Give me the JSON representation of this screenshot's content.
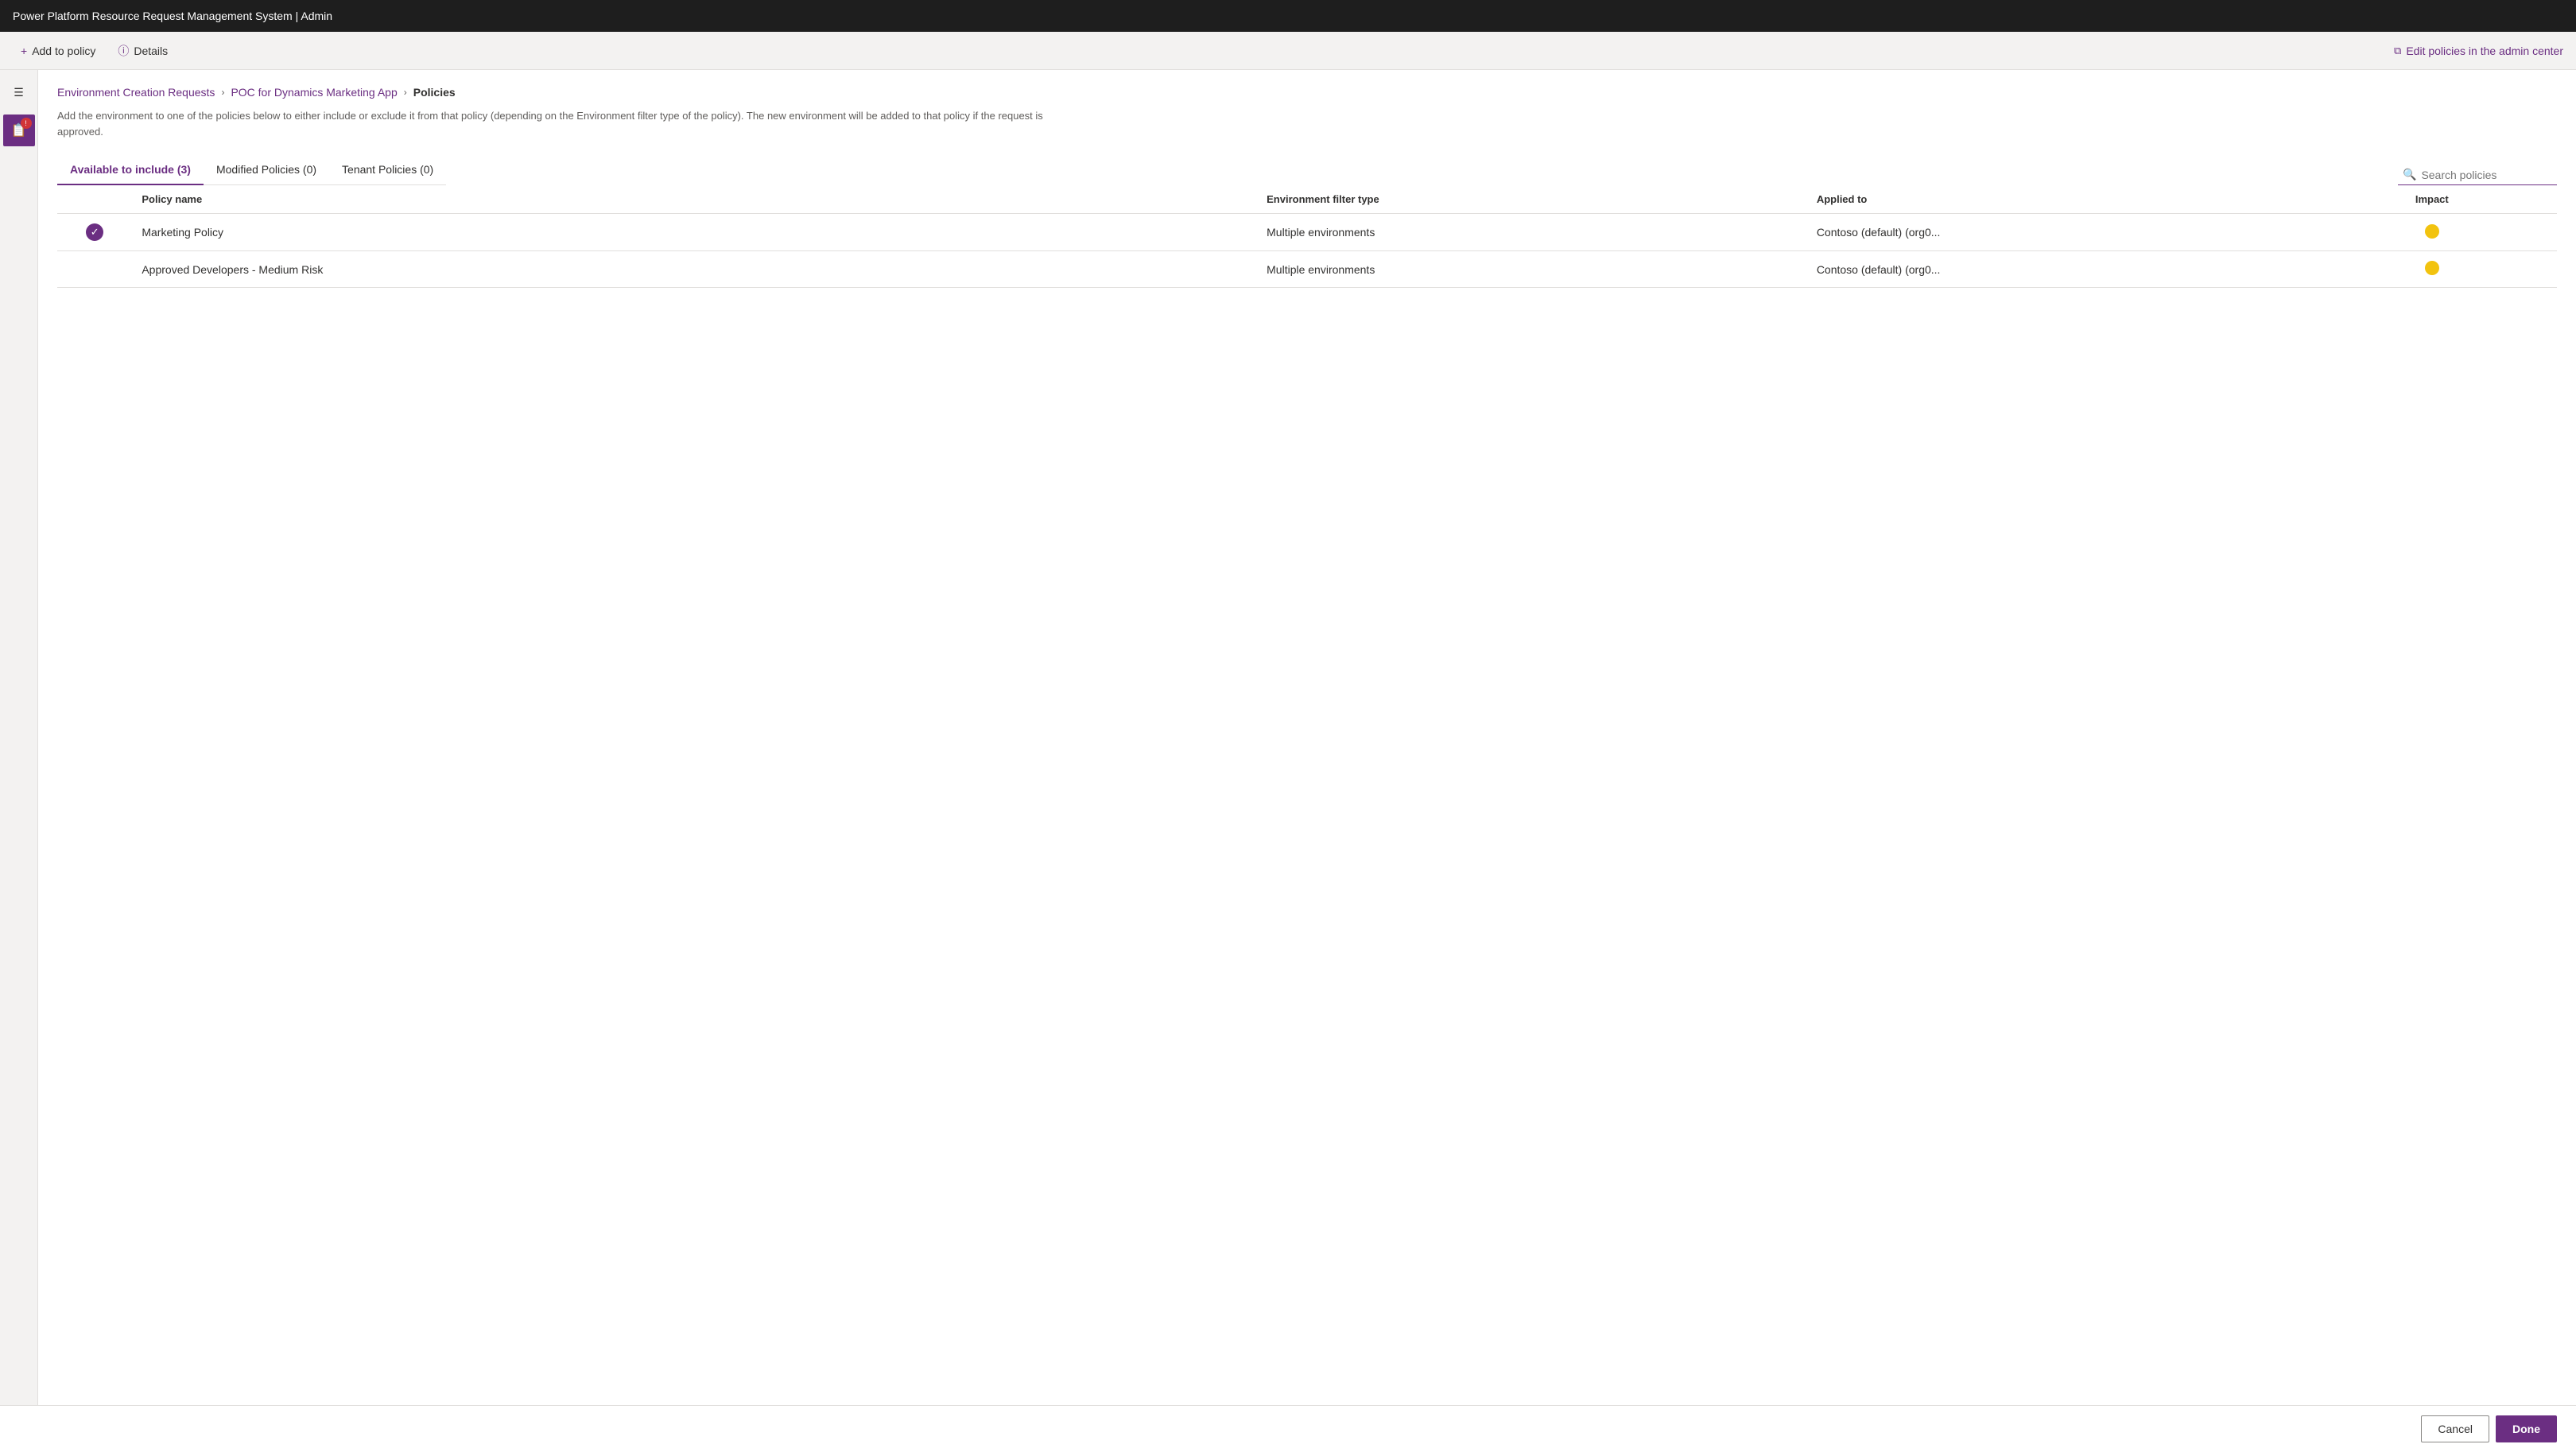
{
  "titleBar": {
    "title": "Power Platform Resource Request Management System | Admin"
  },
  "toolbar": {
    "addToPolicyLabel": "Add to policy",
    "detailsLabel": "Details",
    "editPoliciesLabel": "Edit policies in the admin center"
  },
  "breadcrumb": {
    "items": [
      {
        "label": "Environment Creation Requests",
        "active": false
      },
      {
        "label": "POC for Dynamics Marketing App",
        "active": false
      },
      {
        "label": "Policies",
        "active": true
      }
    ]
  },
  "description": "Add the environment to one of the policies below to either include or exclude it from that policy (depending on the Environment filter type of the policy). The new environment will be added to that policy if the request is approved.",
  "tabs": [
    {
      "label": "Available to include (3)",
      "active": true
    },
    {
      "label": "Modified Policies (0)",
      "active": false
    },
    {
      "label": "Tenant Policies (0)",
      "active": false
    }
  ],
  "search": {
    "placeholder": "Search policies"
  },
  "table": {
    "columns": [
      {
        "key": "check",
        "label": ""
      },
      {
        "key": "policyName",
        "label": "Policy name"
      },
      {
        "key": "envFilterType",
        "label": "Environment filter type"
      },
      {
        "key": "appliedTo",
        "label": "Applied to"
      },
      {
        "key": "impact",
        "label": "Impact"
      }
    ],
    "rows": [
      {
        "checked": true,
        "policyName": "Marketing Policy",
        "envFilterType": "Multiple environments",
        "appliedTo": "Contoso (default) (org0...",
        "impactColor": "yellow"
      },
      {
        "checked": false,
        "policyName": "Approved Developers - Medium Risk",
        "envFilterType": "Multiple environments",
        "appliedTo": "Contoso (default) (org0...",
        "impactColor": "yellow"
      }
    ]
  },
  "buttons": {
    "cancel": "Cancel",
    "done": "Done"
  },
  "icons": {
    "menu": "☰",
    "plus": "+",
    "info": "ⓘ",
    "externalLink": "⧉",
    "search": "🔍",
    "checkmark": "✓",
    "chevronRight": "›",
    "navIcon": "📋"
  },
  "colors": {
    "accent": "#6B2E82",
    "badgeRed": "#d13438",
    "impactYellow": "#f2c30f"
  }
}
